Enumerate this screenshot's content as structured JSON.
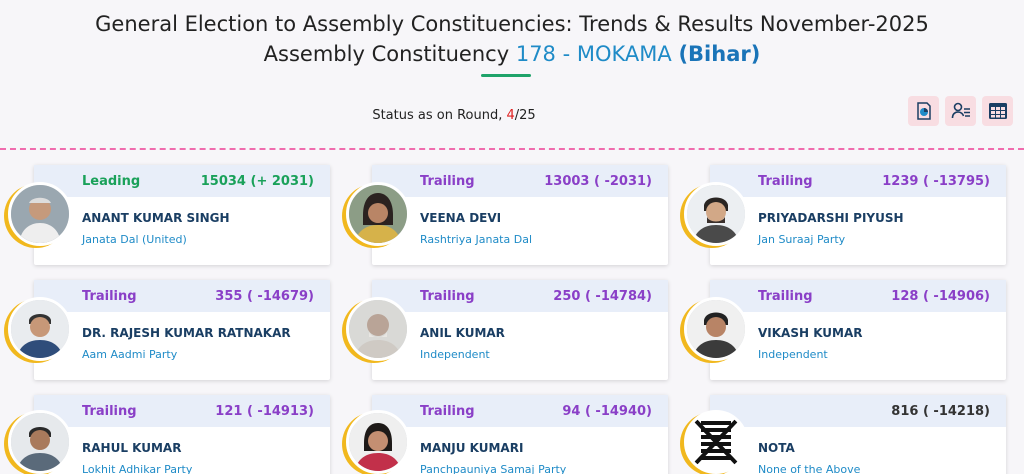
{
  "header": {
    "title": "General Election to Assembly Constituencies: Trends & Results November-2025",
    "subtitle_prefix": "Assembly Constituency",
    "constituency": "178 - MOKAMA",
    "state": "(Bihar)"
  },
  "status": {
    "label": "Status as on Round,",
    "current": "4",
    "total": "/25"
  },
  "toolbar": {
    "icons": [
      "chart-icon",
      "candidate-list-icon",
      "table-icon"
    ]
  },
  "colors": {
    "leading": "#1aa15a",
    "trailing": "#8a3fc7",
    "name": "#1a3e63",
    "party": "#1f8bc7",
    "card_header": "#e8eef9",
    "divider": "#f06cae",
    "avatar_ring": "#f1b81e"
  },
  "candidates": [
    {
      "status": "Leading",
      "votes": "15034 (+ 2031)",
      "name": "ANANT KUMAR SINGH",
      "party": "Janata Dal (United)"
    },
    {
      "status": "Trailing",
      "votes": "13003 ( -2031)",
      "name": "VEENA DEVI",
      "party": "Rashtriya Janata Dal"
    },
    {
      "status": "Trailing",
      "votes": "1239 ( -13795)",
      "name": "PRIYADARSHI PIYUSH",
      "party": "Jan Suraaj Party"
    },
    {
      "status": "Trailing",
      "votes": "355 ( -14679)",
      "name": "DR. RAJESH KUMAR RATNAKAR",
      "party": "Aam Aadmi Party"
    },
    {
      "status": "Trailing",
      "votes": "250 ( -14784)",
      "name": "ANIL KUMAR",
      "party": "Independent"
    },
    {
      "status": "Trailing",
      "votes": "128 ( -14906)",
      "name": "VIKASH KUMAR",
      "party": "Independent"
    },
    {
      "status": "Trailing",
      "votes": "121 ( -14913)",
      "name": "RAHUL KUMAR",
      "party": "Lokhit Adhikar Party"
    },
    {
      "status": "Trailing",
      "votes": "94 ( -14940)",
      "name": "MANJU KUMARI",
      "party": "Panchpauniya Samaj Party"
    },
    {
      "status": "",
      "votes": "816 ( -14218)",
      "name": "NOTA",
      "party": "None of the Above"
    }
  ]
}
